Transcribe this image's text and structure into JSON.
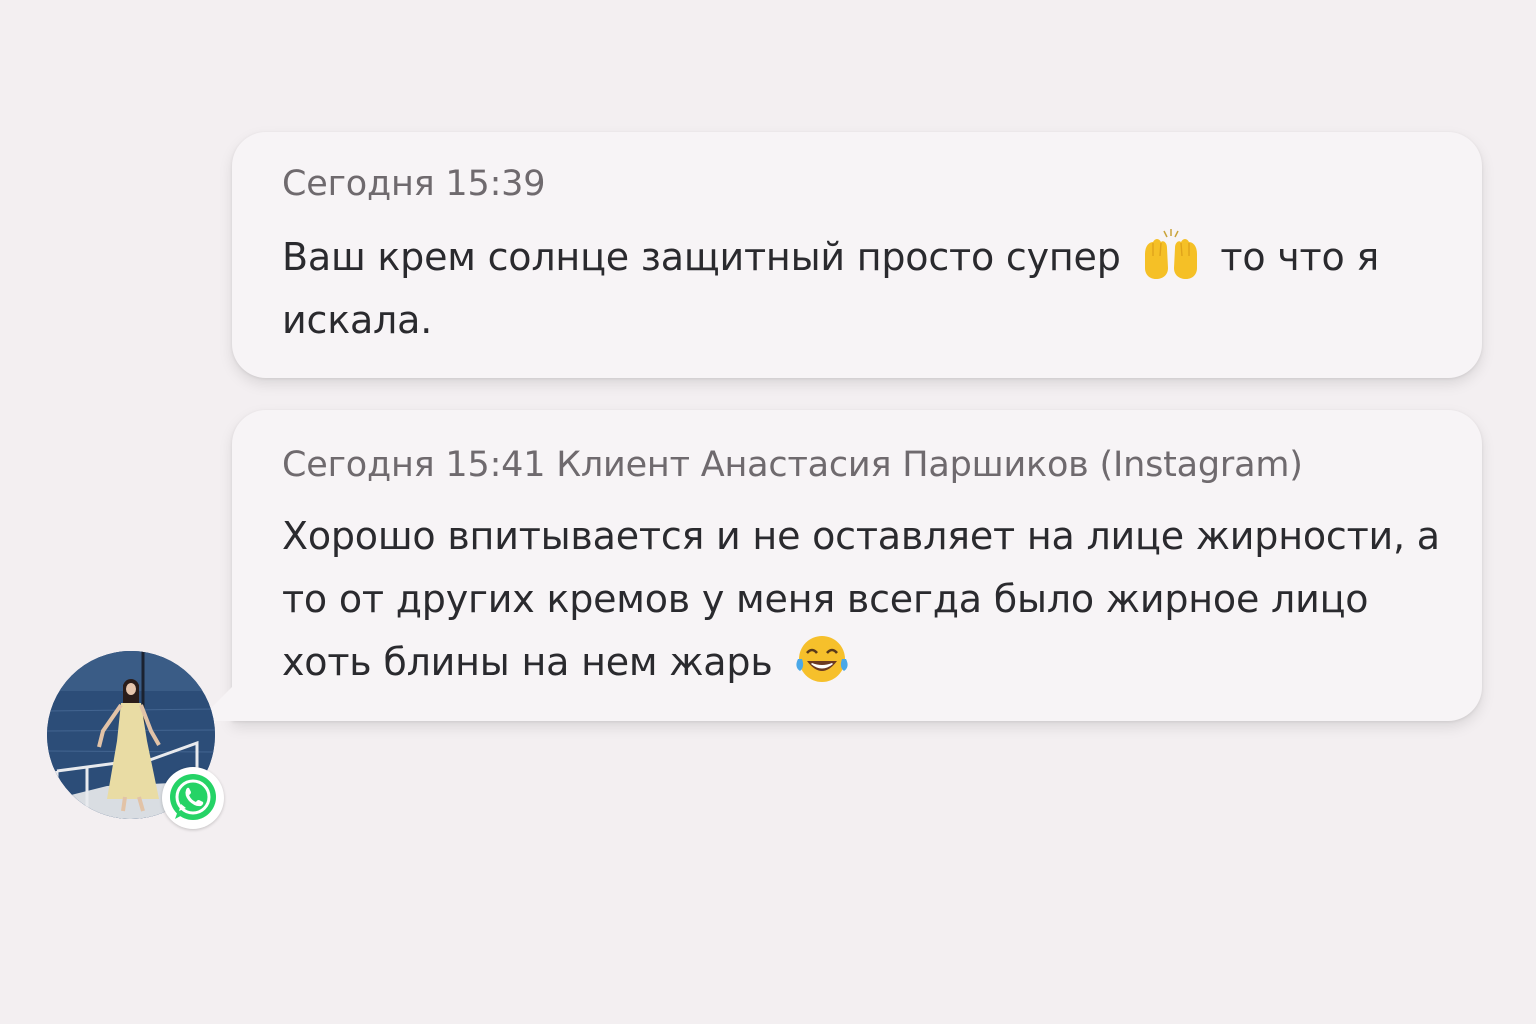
{
  "messages": [
    {
      "meta": "Сегодня 15:39",
      "text_before_emoji": "Ваш крем солнце защитный просто супер ",
      "emoji": "raising-hands-emoji",
      "text_after_emoji": " то что я искала."
    },
    {
      "meta": "Сегодня 15:41 Клиент Анастасия Паршиков (Instagram)",
      "text_before_emoji": "Хорошо впитывается и не оставляет на лице жирности, а то от других кремов у меня всегда было жирное лицо хоть блины на нем жарь ",
      "emoji": "face-with-tears-of-joy-emoji",
      "text_after_emoji": ""
    }
  ],
  "avatar": {
    "icon": "whatsapp-icon",
    "badge_color": "#25d366"
  },
  "colors": {
    "background": "#f3eff1",
    "bubble": "#f7f4f6",
    "meta_text": "#6f6a6e",
    "body_text": "#2a2a2e"
  }
}
